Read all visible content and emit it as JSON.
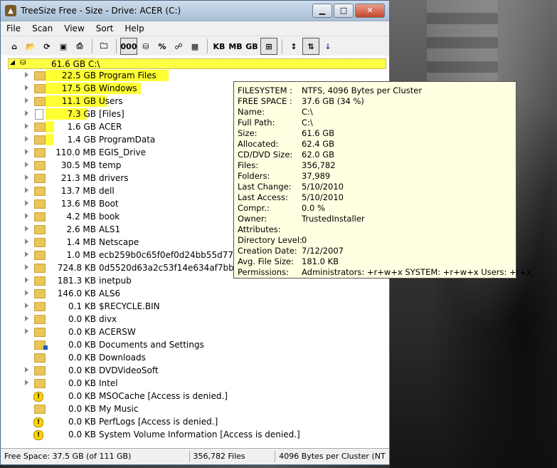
{
  "window": {
    "title": "TreeSize Free - Size - Drive: ACER (C:)"
  },
  "menus": [
    "File",
    "Scan",
    "View",
    "Sort",
    "Help"
  ],
  "toolbar": {
    "kb": "KB",
    "mb": "MB",
    "gb": "GB",
    "percent": "%",
    "count": "000"
  },
  "root": {
    "size": "61.6 GB",
    "name": "C:\\"
  },
  "items": [
    {
      "size": "22.5 GB",
      "name": "Program Files",
      "bar": 0.36,
      "type": "folder",
      "arrow": true
    },
    {
      "size": "17.5 GB",
      "name": "Windows",
      "bar": 0.28,
      "type": "folder",
      "arrow": true
    },
    {
      "size": "11.1 GB",
      "name": "Users",
      "bar": 0.18,
      "type": "folder",
      "arrow": true
    },
    {
      "size": "7.3 GB",
      "name": "[Files]",
      "bar": 0.12,
      "type": "file",
      "arrow": true
    },
    {
      "size": "1.6 GB",
      "name": "ACER",
      "bar": 0.026,
      "type": "folder",
      "arrow": true
    },
    {
      "size": "1.4 GB",
      "name": "ProgramData",
      "bar": 0.022,
      "type": "folder",
      "arrow": true
    },
    {
      "size": "110.0 MB",
      "name": "EGIS_Drive",
      "bar": 0,
      "type": "folder",
      "arrow": true
    },
    {
      "size": "30.5 MB",
      "name": "temp",
      "bar": 0,
      "type": "folder",
      "arrow": true
    },
    {
      "size": "21.3 MB",
      "name": "drivers",
      "bar": 0,
      "type": "folder",
      "arrow": true
    },
    {
      "size": "13.7 MB",
      "name": "dell",
      "bar": 0,
      "type": "folder",
      "arrow": true
    },
    {
      "size": "13.6 MB",
      "name": "Boot",
      "bar": 0,
      "type": "folder",
      "arrow": true
    },
    {
      "size": "4.2 MB",
      "name": "book",
      "bar": 0,
      "type": "folder",
      "arrow": true
    },
    {
      "size": "2.6 MB",
      "name": "ALS1",
      "bar": 0,
      "type": "folder",
      "arrow": true
    },
    {
      "size": "1.4 MB",
      "name": "Netscape",
      "bar": 0,
      "type": "folder",
      "arrow": true
    },
    {
      "size": "1.0 MB",
      "name": "ecb259b0c65f0ef0d24bb55d77",
      "bar": 0,
      "type": "folder",
      "arrow": true
    },
    {
      "size": "724.8 KB",
      "name": "0d5520d63a2c53f14e634af7bbcf",
      "bar": 0,
      "type": "folder",
      "arrow": true
    },
    {
      "size": "181.3 KB",
      "name": "inetpub",
      "bar": 0,
      "type": "folder",
      "arrow": true
    },
    {
      "size": "146.0 KB",
      "name": "ALS6",
      "bar": 0,
      "type": "folder",
      "arrow": true
    },
    {
      "size": "0.1 KB",
      "name": "$RECYCLE.BIN",
      "bar": 0,
      "type": "folder",
      "arrow": true
    },
    {
      "size": "0.0 KB",
      "name": "divx",
      "bar": 0,
      "type": "folder",
      "arrow": true
    },
    {
      "size": "0.0 KB",
      "name": "ACERSW",
      "bar": 0,
      "type": "folder",
      "arrow": true
    },
    {
      "size": "0.0 KB",
      "name": "Documents and Settings",
      "bar": 0,
      "type": "shortcut",
      "arrow": false
    },
    {
      "size": "0.0 KB",
      "name": "Downloads",
      "bar": 0,
      "type": "folder",
      "arrow": false
    },
    {
      "size": "0.0 KB",
      "name": "DVDVideoSoft",
      "bar": 0,
      "type": "folder",
      "arrow": true
    },
    {
      "size": "0.0 KB",
      "name": "Intel",
      "bar": 0,
      "type": "folder",
      "arrow": true
    },
    {
      "size": "0.0 KB",
      "name": "MSOCache  [Access is denied.]",
      "bar": 0,
      "type": "warn",
      "arrow": false
    },
    {
      "size": "0.0 KB",
      "name": "My Music",
      "bar": 0,
      "type": "folder",
      "arrow": false
    },
    {
      "size": "0.0 KB",
      "name": "PerfLogs  [Access is denied.]",
      "bar": 0,
      "type": "warn",
      "arrow": false
    },
    {
      "size": "0.0 KB",
      "name": "System Volume Information  [Access is denied.]",
      "bar": 0,
      "type": "warn",
      "arrow": false
    }
  ],
  "tooltip": [
    {
      "k": "FILESYSTEM :",
      "v": "NTFS, 4096 Bytes per Cluster"
    },
    {
      "k": "FREE SPACE :",
      "v": "37.6 GB  (34 %)"
    },
    {
      "k": "Name:",
      "v": "C:\\"
    },
    {
      "k": "Full Path:",
      "v": "C:\\"
    },
    {
      "k": "Size:",
      "v": "61.6 GB"
    },
    {
      "k": "Allocated:",
      "v": "62.4 GB"
    },
    {
      "k": "CD/DVD Size:",
      "v": "62.0 GB"
    },
    {
      "k": "Files:",
      "v": "356,782"
    },
    {
      "k": "Folders:",
      "v": "37,989"
    },
    {
      "k": "Last Change:",
      "v": "5/10/2010"
    },
    {
      "k": "Last Access:",
      "v": "5/10/2010"
    },
    {
      "k": "Compr.:",
      "v": "0.0 %"
    },
    {
      "k": "Owner:",
      "v": "TrustedInstaller"
    },
    {
      "k": "Attributes:",
      "v": ""
    },
    {
      "k": "Directory Level:",
      "v": "0"
    },
    {
      "k": "Creation Date:",
      "v": "7/12/2007"
    },
    {
      "k": "Avg. File Size:",
      "v": "181.0 KB"
    },
    {
      "k": "Permissions:",
      "v": "Administrators: +r+w+x   SYSTEM: +r+w+x   Users: +r+x"
    }
  ],
  "status": {
    "free": "Free Space: 37.5 GB  (of 111 GB)",
    "files": "356,782  Files",
    "cluster": "4096 Bytes per Cluster (NT"
  }
}
